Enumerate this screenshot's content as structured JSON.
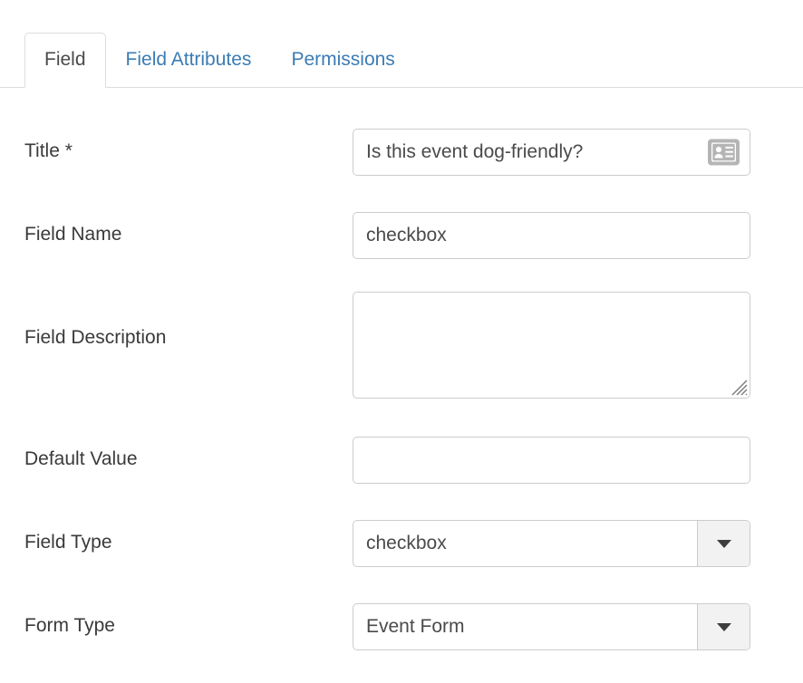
{
  "tabs": [
    {
      "label": "Field",
      "active": true
    },
    {
      "label": "Field Attributes",
      "active": false
    },
    {
      "label": "Permissions",
      "active": false
    }
  ],
  "form": {
    "title": {
      "label": "Title *",
      "value": "Is this event dog-friendly?",
      "icon": "vcard-icon"
    },
    "field_name": {
      "label": "Field Name",
      "value": "checkbox"
    },
    "field_description": {
      "label": "Field Description",
      "value": ""
    },
    "default_value": {
      "label": "Default Value",
      "value": ""
    },
    "field_type": {
      "label": "Field Type",
      "value": "checkbox",
      "caret": "chevron-down-icon"
    },
    "form_type": {
      "label": "Form Type",
      "value": "Event Form",
      "caret": "chevron-down-icon"
    }
  },
  "colors": {
    "link": "#3b7cb4",
    "border": "#cccccc",
    "tab_border": "#dddddd",
    "text": "#3a3a3a",
    "select_button": "#f2f2f2",
    "icon_gray": "#b5b5b5"
  }
}
